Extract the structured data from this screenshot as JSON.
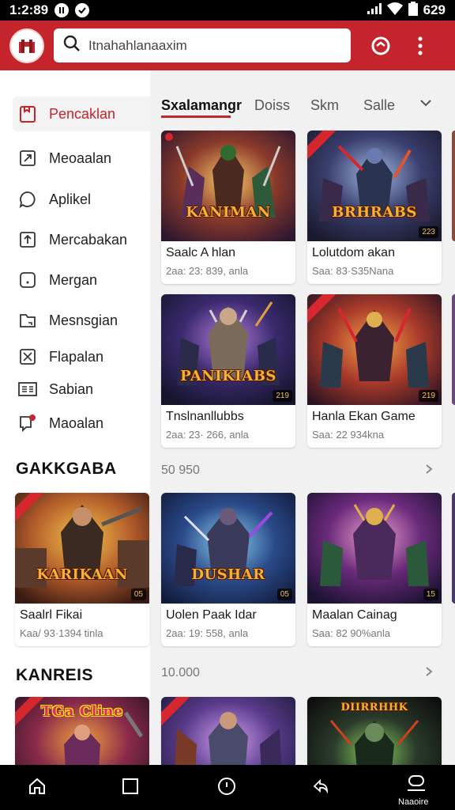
{
  "status_bar": {
    "time": "1:2:89",
    "battery": "629"
  },
  "search": {
    "text": "Itnahahlanaaxim"
  },
  "sidebar": {
    "items": [
      {
        "label": "Pencaklan",
        "icon": "bookmark-icon"
      },
      {
        "label": "Meoaalan",
        "icon": "share-icon"
      },
      {
        "label": "Aplikel",
        "icon": "chat-icon"
      },
      {
        "label": "Mercabakan",
        "icon": "upload-icon"
      },
      {
        "label": "Mergan",
        "icon": "square-icon"
      },
      {
        "label": "Mesnsgian",
        "icon": "folder-icon"
      },
      {
        "label": "Flapalan",
        "icon": "expand-icon"
      },
      {
        "label": "Sabian",
        "icon": "list-icon"
      },
      {
        "label": "Maoalan",
        "icon": "notification-icon"
      }
    ],
    "section1": "GAKKGABA",
    "section2": "KANREIS"
  },
  "tabs": [
    "Sxalamangr",
    "Doiss",
    "Skm",
    "Salle"
  ],
  "rows": [
    {
      "label": "50 950"
    },
    {
      "label": "10.000"
    }
  ],
  "cards": {
    "c1": {
      "title": "KANIMAN",
      "badge": "",
      "name": "Saalc A hlan",
      "meta": "2aa: 23: 839, anla"
    },
    "c2": {
      "title": "BRHRABS",
      "badge": "223",
      "name": "Lolutdom akan",
      "meta": "Saa: 83·S35Nana"
    },
    "c3": {
      "title": "PANIKIABS",
      "badge": "219",
      "name": "Tnslnanllubbs",
      "meta": "2aa: 23· 266, anla"
    },
    "c4": {
      "title": "",
      "badge": "219",
      "name": "Hanla Ekan Game",
      "meta": "Saa: 22 934kna"
    },
    "c5": {
      "title": "KARIKAAN",
      "badge": "05",
      "name": "Saalrl Fikai",
      "meta": "Kaa/ 93·1394 tinla"
    },
    "c6": {
      "title": "DUSHAR",
      "badge": "05",
      "name": "Uolen Paak Idar",
      "meta": "2aa: 19: 558, anla"
    },
    "c7": {
      "title": "",
      "badge": "15",
      "name": "Maalan Cainag",
      "meta": "Saa: 82 90%anla"
    },
    "c8": {
      "title": "TGa Cline",
      "badge": "",
      "name": "",
      "meta": ""
    },
    "c9": {
      "title": "",
      "badge": "",
      "name": "",
      "meta": ""
    },
    "c10": {
      "title": "DIIRRHHK",
      "badge": "",
      "name": "",
      "meta": ""
    }
  },
  "bottom_nav": {
    "label": "Naaoire"
  },
  "colors": {
    "brand": "#c4242c"
  }
}
